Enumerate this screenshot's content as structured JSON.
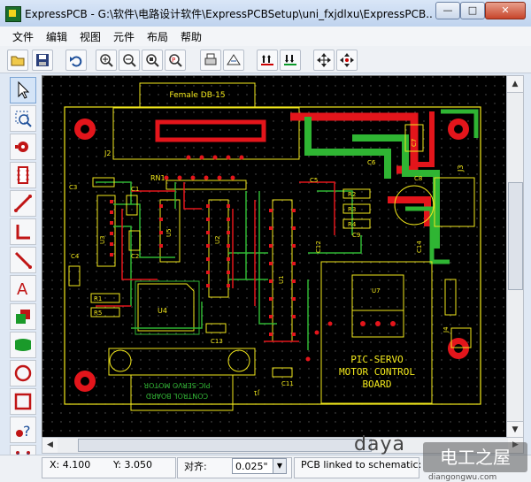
{
  "window": {
    "title": "ExpressPCB - G:\\软件\\电路设计软件\\ExpressPCBSetup\\uni_fxjdlxu\\ExpressPCB...",
    "minimize_label": "—",
    "maximize_label": "□",
    "close_label": "✕"
  },
  "menu": {
    "items": [
      "文件",
      "编辑",
      "视图",
      "元件",
      "布局",
      "帮助"
    ]
  },
  "toolbar": {
    "buttons": [
      "open-icon",
      "save-icon",
      "undo-icon",
      "zoom-in-icon",
      "zoom-out-icon",
      "zoom-fit-icon",
      "zoom-area-icon",
      "print-icon",
      "layout-icon",
      "trace-up-icon",
      "trace-down-icon",
      "move-icon",
      "rotate-icon"
    ]
  },
  "left_tools": [
    "select-arrow-icon",
    "zoom-select-icon",
    "pad-icon",
    "component-icon",
    "trace-icon",
    "corner-icon",
    "diagonal-icon",
    "text-icon",
    "layer-icon",
    "plane-icon",
    "circle-icon",
    "rectangle-icon",
    "help-icon",
    "netlist-icon"
  ],
  "pcb": {
    "labels": {
      "conn_top": "Female DB-15",
      "J2": "J2",
      "RN1": "RN1",
      "J3": "J3",
      "C1": "C1",
      "C3": "C3",
      "C2": "C2",
      "C4": "C4",
      "C5": "C5",
      "C6": "C6",
      "C7": "C7",
      "C8": "C8",
      "C9": "C9",
      "C11": "C11",
      "C12": "C12",
      "C13": "C13",
      "C14": "C14",
      "U3": "U3",
      "U5": "U5",
      "U2": "U2",
      "U1": "U1",
      "U4": "U4",
      "U7": "U7",
      "R1": "R1",
      "R2": "R2",
      "R3": "R3",
      "R4": "R4",
      "R5": "R5",
      "J1": "J1",
      "J4": "J4",
      "board_line1": "PIC-SERVO",
      "board_line2": "MOTOR CONTROL",
      "board_line3": "BOARD",
      "mirror_line1": "PIC-SERVO MOTOR",
      "mirror_line2": "CONTROL BOARD"
    }
  },
  "status": {
    "x_label": "X: 4.100",
    "y_label": "Y: 3.050",
    "align_label": "对齐:",
    "align_value": "0.025\"",
    "link_text": "PCB linked to schematic:"
  },
  "watermark": {
    "logo_text": "daya",
    "cn_text": "电工之屋",
    "site_text": "diangongwu.com"
  },
  "colors": {
    "pcb_background": "#000000",
    "silkscreen": "#f2e81c",
    "top_copper": "#e3151b",
    "bottom_copper": "#2fb533",
    "grid": "#5a5a5a"
  }
}
